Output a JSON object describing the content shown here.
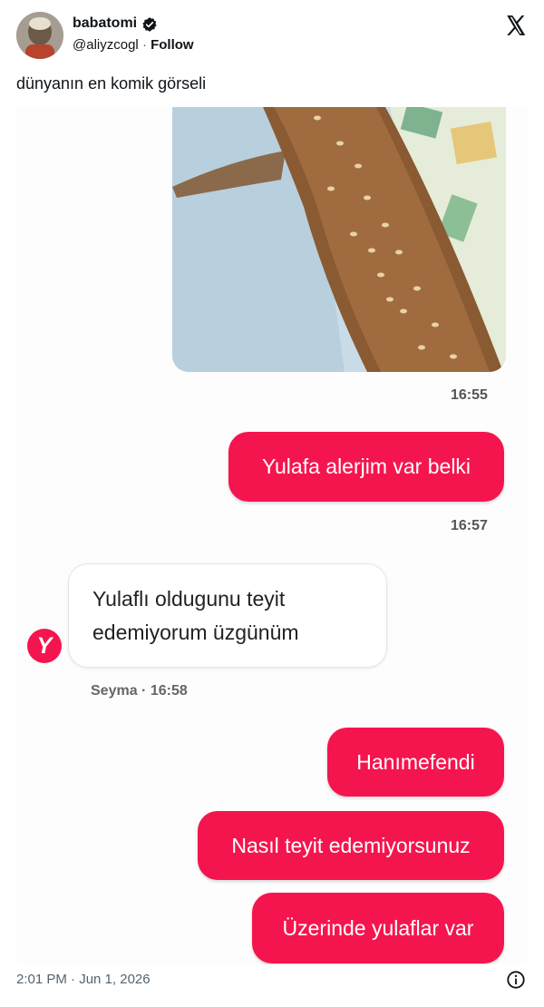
{
  "header": {
    "display_name": "babatomi",
    "handle": "@aliyzcogl",
    "separator": "·",
    "follow_label": "Follow"
  },
  "tweet": {
    "text": "dünyanın en komik görseli"
  },
  "chat": {
    "photo_time": "16:55",
    "messages_out_1": "Yulafa alerjim var belki",
    "time_2": "16:57",
    "reply_line_1": "Yulaflı oldugunu teyit",
    "reply_line_2": "edemiyorum üzgünüm",
    "reply_avatar_letter": "Y",
    "reply_meta": "Seyma · 16:58",
    "out_2": "Hanımefendi",
    "out_3": "Nasıl teyit edemiyorsunuz",
    "out_4": "Üzerinde yulaflar var"
  },
  "footer": {
    "timestamp": "2:01 PM · Jun 1, 2026"
  },
  "colors": {
    "accent": "#f5154e",
    "verified": "#0f1419"
  },
  "icons": [
    "x-logo-icon",
    "verified-badge-icon",
    "info-icon",
    "chat-app-logo-icon"
  ]
}
